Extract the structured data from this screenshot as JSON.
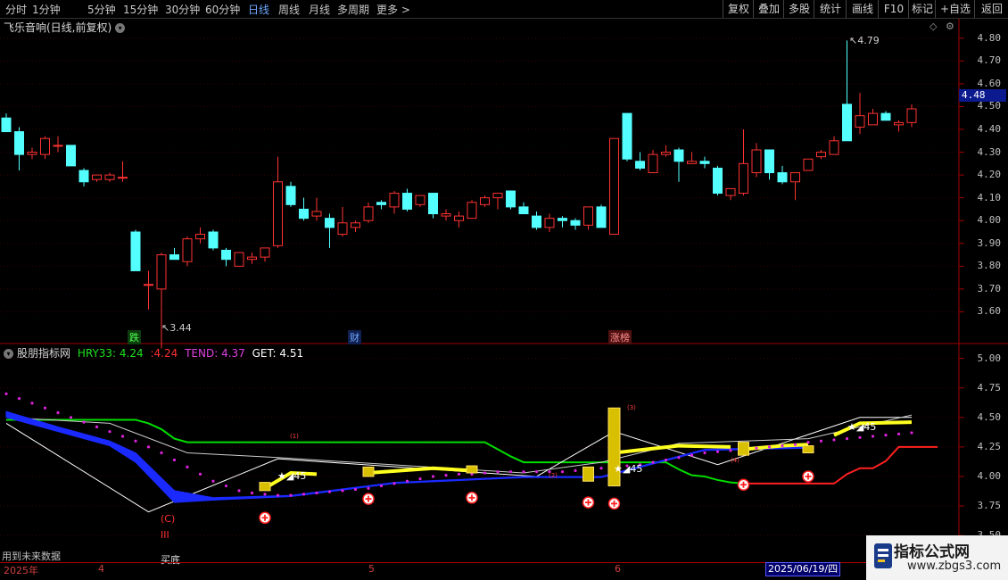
{
  "toolbar": {
    "periods": [
      "分时",
      "1分钟",
      "5分钟",
      "15分钟",
      "30分钟",
      "60分钟",
      "日线",
      "周线",
      "月线",
      "多周期",
      "更多 >"
    ],
    "active_period": "日线",
    "right_buttons": [
      "复权",
      "叠加",
      "多股",
      "统计",
      "画线",
      "F10",
      "+自选",
      "返回"
    ],
    "mark_button": "标记"
  },
  "main_chart": {
    "title": "飞乐音响(日线,前复权)",
    "current_price": "4.48",
    "high_label": "4.79",
    "low_label": "3.44",
    "events": [
      "跌",
      "财",
      "涨榜"
    ],
    "y_ticks": [
      "4.80",
      "4.70",
      "4.60",
      "4.50",
      "4.40",
      "4.30",
      "4.20",
      "4.10",
      "4.00",
      "3.90",
      "3.80",
      "3.70",
      "3.60"
    ],
    "y_range": [
      3.5,
      4.85
    ],
    "colors": {
      "up": "#ff3232",
      "down": "#54ffff",
      "bg": "#000000"
    },
    "candles": [
      {
        "o": 4.45,
        "h": 4.47,
        "l": 4.39,
        "c": 4.39
      },
      {
        "o": 4.39,
        "h": 4.41,
        "l": 4.22,
        "c": 4.29
      },
      {
        "o": 4.29,
        "h": 4.32,
        "l": 4.27,
        "c": 4.3
      },
      {
        "o": 4.29,
        "h": 4.37,
        "l": 4.27,
        "c": 4.36
      },
      {
        "o": 4.33,
        "h": 4.37,
        "l": 4.3,
        "c": 4.33
      },
      {
        "o": 4.33,
        "h": 4.33,
        "l": 4.24,
        "c": 4.24
      },
      {
        "o": 4.22,
        "h": 4.23,
        "l": 4.15,
        "c": 4.17
      },
      {
        "o": 4.18,
        "h": 4.2,
        "l": 4.17,
        "c": 4.2
      },
      {
        "o": 4.18,
        "h": 4.21,
        "l": 4.17,
        "c": 4.2
      },
      {
        "o": 4.19,
        "h": 4.26,
        "l": 4.17,
        "c": 4.19
      },
      {
        "o": 3.95,
        "h": 3.96,
        "l": 3.78,
        "c": 3.78
      },
      {
        "o": 3.72,
        "h": 3.78,
        "l": 3.61,
        "c": 3.72
      },
      {
        "o": 3.7,
        "h": 3.86,
        "l": 3.44,
        "c": 3.85
      },
      {
        "o": 3.85,
        "h": 3.88,
        "l": 3.83,
        "c": 3.83
      },
      {
        "o": 3.82,
        "h": 3.93,
        "l": 3.8,
        "c": 3.92
      },
      {
        "o": 3.92,
        "h": 3.97,
        "l": 3.9,
        "c": 3.94
      },
      {
        "o": 3.95,
        "h": 3.96,
        "l": 3.87,
        "c": 3.88
      },
      {
        "o": 3.87,
        "h": 3.88,
        "l": 3.8,
        "c": 3.83
      },
      {
        "o": 3.8,
        "h": 3.86,
        "l": 3.8,
        "c": 3.86
      },
      {
        "o": 3.83,
        "h": 3.86,
        "l": 3.81,
        "c": 3.84
      },
      {
        "o": 3.84,
        "h": 3.88,
        "l": 3.82,
        "c": 3.88
      },
      {
        "o": 3.89,
        "h": 4.28,
        "l": 3.88,
        "c": 4.17
      },
      {
        "o": 4.15,
        "h": 4.17,
        "l": 4.06,
        "c": 4.07
      },
      {
        "o": 4.05,
        "h": 4.1,
        "l": 4.0,
        "c": 4.01
      },
      {
        "o": 4.02,
        "h": 4.1,
        "l": 4.0,
        "c": 4.04
      },
      {
        "o": 4.01,
        "h": 4.03,
        "l": 3.88,
        "c": 3.97
      },
      {
        "o": 3.94,
        "h": 4.06,
        "l": 3.93,
        "c": 3.99
      },
      {
        "o": 3.97,
        "h": 4.0,
        "l": 3.95,
        "c": 3.99
      },
      {
        "o": 4.0,
        "h": 4.08,
        "l": 3.99,
        "c": 4.06
      },
      {
        "o": 4.08,
        "h": 4.09,
        "l": 4.05,
        "c": 4.07
      },
      {
        "o": 4.06,
        "h": 4.13,
        "l": 4.03,
        "c": 4.12
      },
      {
        "o": 4.12,
        "h": 4.14,
        "l": 4.04,
        "c": 4.05
      },
      {
        "o": 4.07,
        "h": 4.11,
        "l": 4.06,
        "c": 4.11
      },
      {
        "o": 4.12,
        "h": 4.12,
        "l": 4.01,
        "c": 4.03
      },
      {
        "o": 4.02,
        "h": 4.05,
        "l": 4.0,
        "c": 4.03
      },
      {
        "o": 4.0,
        "h": 4.04,
        "l": 3.97,
        "c": 4.02
      },
      {
        "o": 4.01,
        "h": 4.09,
        "l": 4.01,
        "c": 4.08
      },
      {
        "o": 4.07,
        "h": 4.11,
        "l": 4.06,
        "c": 4.1
      },
      {
        "o": 4.1,
        "h": 4.12,
        "l": 4.05,
        "c": 4.12
      },
      {
        "o": 4.13,
        "h": 4.13,
        "l": 4.05,
        "c": 4.06
      },
      {
        "o": 4.06,
        "h": 4.08,
        "l": 4.03,
        "c": 4.03
      },
      {
        "o": 4.02,
        "h": 4.04,
        "l": 3.96,
        "c": 3.97
      },
      {
        "o": 3.97,
        "h": 4.03,
        "l": 3.95,
        "c": 4.01
      },
      {
        "o": 4.01,
        "h": 4.02,
        "l": 3.97,
        "c": 4.0
      },
      {
        "o": 4.0,
        "h": 4.01,
        "l": 3.96,
        "c": 3.98
      },
      {
        "o": 3.98,
        "h": 4.06,
        "l": 3.96,
        "c": 4.06
      },
      {
        "o": 4.06,
        "h": 4.07,
        "l": 3.97,
        "c": 3.97
      },
      {
        "o": 3.94,
        "h": 4.36,
        "l": 3.94,
        "c": 4.36
      },
      {
        "o": 4.47,
        "h": 4.47,
        "l": 4.26,
        "c": 4.27
      },
      {
        "o": 4.26,
        "h": 4.3,
        "l": 4.22,
        "c": 4.23
      },
      {
        "o": 4.21,
        "h": 4.31,
        "l": 4.21,
        "c": 4.29
      },
      {
        "o": 4.29,
        "h": 4.33,
        "l": 4.28,
        "c": 4.3
      },
      {
        "o": 4.31,
        "h": 4.32,
        "l": 4.17,
        "c": 4.26
      },
      {
        "o": 4.25,
        "h": 4.3,
        "l": 4.25,
        "c": 4.26
      },
      {
        "o": 4.26,
        "h": 4.28,
        "l": 4.23,
        "c": 4.25
      },
      {
        "o": 4.23,
        "h": 4.24,
        "l": 4.11,
        "c": 4.12
      },
      {
        "o": 4.11,
        "h": 4.14,
        "l": 4.09,
        "c": 4.14
      },
      {
        "o": 4.12,
        "h": 4.4,
        "l": 4.11,
        "c": 4.25
      },
      {
        "o": 4.21,
        "h": 4.34,
        "l": 4.19,
        "c": 4.31
      },
      {
        "o": 4.31,
        "h": 4.31,
        "l": 4.18,
        "c": 4.21
      },
      {
        "o": 4.21,
        "h": 4.24,
        "l": 4.16,
        "c": 4.17
      },
      {
        "o": 4.17,
        "h": 4.21,
        "l": 4.09,
        "c": 4.21
      },
      {
        "o": 4.22,
        "h": 4.27,
        "l": 4.22,
        "c": 4.27
      },
      {
        "o": 4.28,
        "h": 4.31,
        "l": 4.27,
        "c": 4.3
      },
      {
        "o": 4.29,
        "h": 4.37,
        "l": 4.29,
        "c": 4.35
      },
      {
        "o": 4.51,
        "h": 4.79,
        "l": 4.4,
        "c": 4.35
      },
      {
        "o": 4.41,
        "h": 4.56,
        "l": 4.38,
        "c": 4.46
      },
      {
        "o": 4.42,
        "h": 4.49,
        "l": 4.42,
        "c": 4.47
      },
      {
        "o": 4.47,
        "h": 4.48,
        "l": 4.44,
        "c": 4.44
      },
      {
        "o": 4.42,
        "h": 4.44,
        "l": 4.39,
        "c": 4.43
      },
      {
        "o": 4.43,
        "h": 4.51,
        "l": 4.41,
        "c": 4.49
      }
    ]
  },
  "indicator": {
    "name": "股朋指标网",
    "hry_label": "HRY33:",
    "hry_value": "4.24",
    "hry_value2": "4.24",
    "tend_label": "TEND:",
    "tend_value": "4.37",
    "get_label": "GET:",
    "get_value": "4.51",
    "y_ticks": [
      "5.00",
      "4.75",
      "4.50",
      "4.25",
      "4.00",
      "3.75",
      "3.50"
    ],
    "y_range": [
      3.35,
      5.05
    ],
    "colors": {
      "hry": "#00dd00",
      "tend": "#dd22dd",
      "get": "#ffffff",
      "hry_red": "#ff2020"
    },
    "annotations": [
      "★◢45",
      "★◢45",
      "★◢45",
      "(C)",
      "III",
      "买底",
      "(1)",
      "(2)",
      "(3)",
      "(4)"
    ],
    "future_note": "用到未来数据",
    "green_line": [
      4.48,
      4.48,
      4.48,
      4.48,
      4.48,
      4.48,
      4.48,
      4.48,
      4.48,
      4.48,
      4.48,
      4.45,
      4.4,
      4.32,
      4.29,
      4.29,
      4.29,
      4.29,
      4.29,
      4.29,
      4.29,
      4.29,
      4.29,
      4.29,
      4.29,
      4.29,
      4.29,
      4.29,
      4.29,
      4.29,
      4.29,
      4.29,
      4.29,
      4.29,
      4.29,
      4.29,
      4.29,
      4.29,
      4.23,
      4.17,
      4.12,
      4.12,
      4.12,
      4.12,
      4.12,
      4.12,
      4.12,
      4.12,
      4.12,
      4.12,
      4.12,
      4.12,
      4.06,
      4.01,
      4.0,
      3.97,
      3.95,
      3.94
    ],
    "red_line": [
      3.94,
      3.94,
      3.94,
      3.94,
      3.94,
      3.94,
      3.94,
      3.94,
      4.02,
      4.07,
      4.07,
      4.13,
      4.25,
      4.25,
      4.25,
      4.25
    ]
  },
  "date_axis": {
    "labels": [
      "2025年",
      "4",
      "5",
      "6"
    ],
    "current_date": "2025/06/19/四"
  },
  "watermark": {
    "top": "指标公式网",
    "bottom": "www.zbgs3.com"
  }
}
